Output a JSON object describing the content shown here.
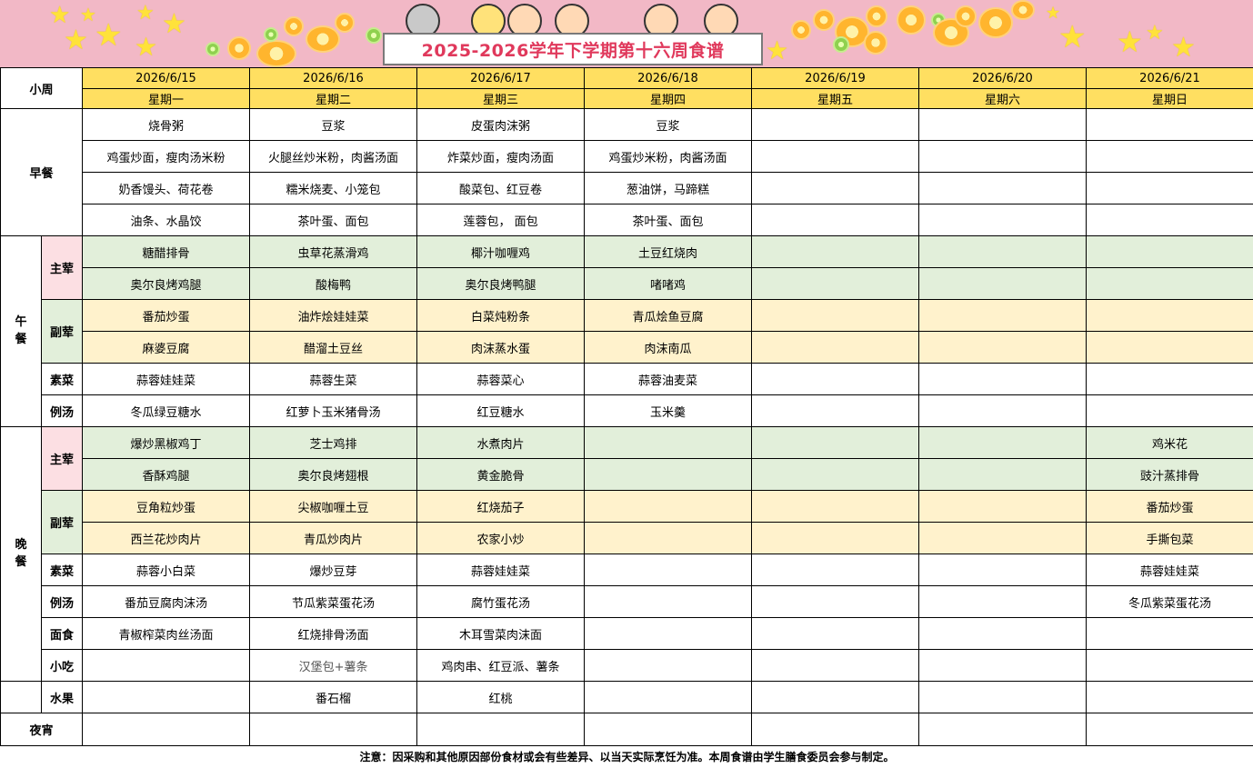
{
  "title": "2025-2026学年下学期第十六周食谱",
  "header": {
    "week_label": "小周",
    "dates": [
      "2026/6/15",
      "2026/6/16",
      "2026/6/17",
      "2026/6/18",
      "2026/6/19",
      "2026/6/20",
      "2026/6/21"
    ],
    "days": [
      "星期一",
      "星期二",
      "星期三",
      "星期四",
      "星期五",
      "星期六",
      "星期日"
    ]
  },
  "labels": {
    "breakfast": "早餐",
    "lunch": "午餐",
    "dinner": "晚餐",
    "main": "主荤",
    "side": "副荤",
    "veg": "素菜",
    "soup": "例汤",
    "noodle": "面食",
    "snack": "小吃",
    "fruit": "水果",
    "supper": "夜宵"
  },
  "breakfast": [
    [
      "烧骨粥",
      "豆浆",
      "皮蛋肉沫粥",
      "豆浆",
      "",
      "",
      ""
    ],
    [
      "鸡蛋炒面，瘦肉汤米粉",
      "火腿丝炒米粉，肉酱汤面",
      "炸菜炒面，瘦肉汤面",
      "鸡蛋炒米粉，肉酱汤面",
      "",
      "",
      ""
    ],
    [
      "奶香馒头、荷花卷",
      "糯米烧麦、小笼包",
      "酸菜包、红豆卷",
      "葱油饼，马蹄糕",
      "",
      "",
      ""
    ],
    [
      "油条、水晶饺",
      "茶叶蛋、面包",
      "莲蓉包，  面包",
      "茶叶蛋、面包",
      "",
      "",
      ""
    ]
  ],
  "lunch": {
    "main": [
      [
        "糖醋排骨",
        "虫草花蒸滑鸡",
        "椰汁咖喱鸡",
        "土豆红烧肉",
        "",
        "",
        ""
      ],
      [
        "奥尔良烤鸡腿",
        "酸梅鸭",
        "奥尔良烤鸭腿",
        "啫啫鸡",
        "",
        "",
        ""
      ]
    ],
    "side": [
      [
        "番茄炒蛋",
        "油炸烩娃娃菜",
        "白菜炖粉条",
        "青瓜烩鱼豆腐",
        "",
        "",
        ""
      ],
      [
        "麻婆豆腐",
        "醋溜土豆丝",
        "肉沫蒸水蛋",
        "肉沫南瓜",
        "",
        "",
        ""
      ]
    ],
    "veg": [
      "蒜蓉娃娃菜",
      "蒜蓉生菜",
      "蒜蓉菜心",
      "蒜蓉油麦菜",
      "",
      "",
      ""
    ],
    "soup": [
      "冬瓜绿豆糖水",
      "红萝卜玉米猪骨汤",
      "红豆糖水",
      "玉米羹",
      "",
      "",
      ""
    ]
  },
  "dinner": {
    "main": [
      [
        "爆炒黑椒鸡丁",
        "芝士鸡排",
        "水煮肉片",
        "",
        "",
        "",
        "鸡米花"
      ],
      [
        "香酥鸡腿",
        "奥尔良烤翅根",
        "黄金脆骨",
        "",
        "",
        "",
        "豉汁蒸排骨"
      ]
    ],
    "side": [
      [
        "豆角粒炒蛋",
        "尖椒咖喱土豆",
        "红烧茄子",
        "",
        "",
        "",
        "番茄炒蛋"
      ],
      [
        "西兰花炒肉片",
        "青瓜炒肉片",
        "农家小炒",
        "",
        "",
        "",
        "手撕包菜"
      ]
    ],
    "veg": [
      "蒜蓉小白菜",
      "爆炒豆芽",
      "蒜蓉娃娃菜",
      "",
      "",
      "",
      "蒜蓉娃娃菜"
    ],
    "soup": [
      "番茄豆腐肉沫汤",
      "节瓜紫菜蛋花汤",
      "腐竹蛋花汤",
      "",
      "",
      "",
      "冬瓜紫菜蛋花汤"
    ],
    "noodle": [
      "青椒榨菜肉丝汤面",
      "红烧排骨汤面",
      "木耳雪菜肉沫面",
      "",
      "",
      "",
      ""
    ],
    "snack": [
      "",
      "汉堡包+薯条",
      "鸡肉串、红豆派、薯条",
      "",
      "",
      "",
      ""
    ]
  },
  "fruit": [
    "",
    "番石榴",
    "红桃",
    "",
    "",
    "",
    ""
  ],
  "supper": [
    "",
    "",
    "",
    "",
    "",
    "",
    ""
  ],
  "note": "注意：因采购和其他原因部份食材或会有些差异、以当天实际烹饪为准。本周食谱由学生膳食委员会参与制定。",
  "colors": {
    "banner": "#f2b8c6",
    "header": "#ffdf61",
    "main_bg": "#e2efda",
    "side_bg": "#fff2cc",
    "label_pink": "#fcdfe3",
    "title": "#e0395c"
  }
}
